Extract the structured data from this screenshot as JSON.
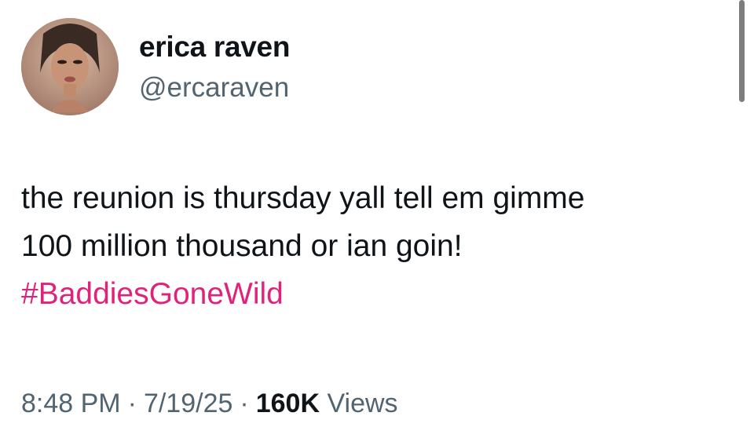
{
  "author": {
    "display_name": "erica raven",
    "handle": "@ercaraven",
    "avatar_icon": "profile-photo"
  },
  "tweet": {
    "line1": "the reunion is thursday yall tell em gimme",
    "line2": "100 million thousand or ian goin!",
    "hashtag": "#BaddiesGoneWild",
    "hashtag_color": "#e0237a"
  },
  "meta": {
    "time": "8:48 PM",
    "separator": "·",
    "date": "7/19/25",
    "views_count": "160K",
    "views_label": "Views"
  },
  "colors": {
    "text": "#0f1419",
    "secondary": "#536471"
  }
}
